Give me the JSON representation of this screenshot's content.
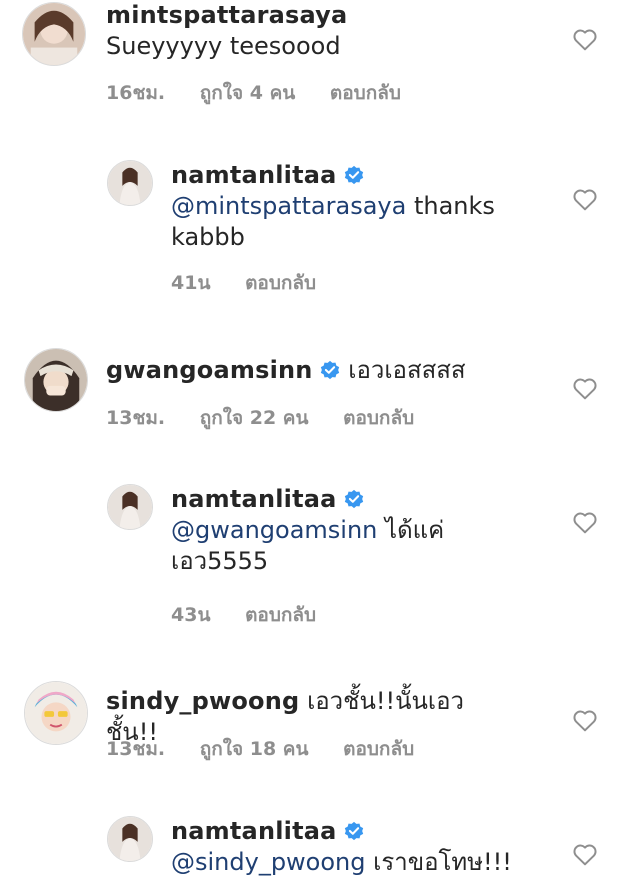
{
  "comments": [
    {
      "username": "mintspattarasaya",
      "mention": "",
      "text": "Sueyyyyy teesoood",
      "time": "16ชม.",
      "likes": "ถูกใจ 4 คน",
      "reply": "ตอบกลับ"
    },
    {
      "username": "namtanlitaa",
      "mention": "@mintspattarasaya",
      "text": " thanks kabbb",
      "time": "41น",
      "likes": "",
      "reply": "ตอบกลับ"
    },
    {
      "username": "gwangoamsinn",
      "mention": "",
      "text": "เอวเอสสสส",
      "time": "13ชม.",
      "likes": "ถูกใจ 22 คน",
      "reply": "ตอบกลับ"
    },
    {
      "username": "namtanlitaa",
      "mention": "@gwangoamsinn",
      "text": " ได้แค่เอว5555",
      "time": "43น",
      "likes": "",
      "reply": "ตอบกลับ"
    },
    {
      "username": "sindy_pwoong",
      "mention": "",
      "text": "เอวชั้น!!นั้นเอวชั้น!!",
      "time": "13ชม.",
      "likes": "ถูกใจ 18 คน",
      "reply": "ตอบกลับ"
    },
    {
      "username": "namtanlitaa",
      "mention": "@sindy_pwoong",
      "text": " เราขอโทษ!!!",
      "time": "",
      "likes": "",
      "reply": ""
    }
  ],
  "icons": {
    "like": "heart-outline-icon",
    "verified": "verified-badge-icon"
  },
  "colors": {
    "mention": "#1f3f72",
    "verified": "#3897f0",
    "meta": "#8e8e8e"
  }
}
